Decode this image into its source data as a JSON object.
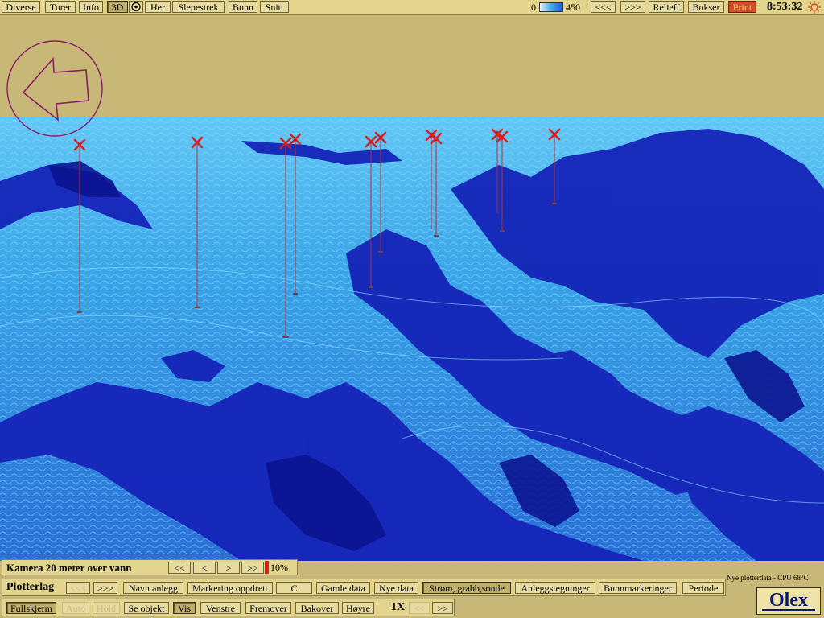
{
  "menu": {
    "items": [
      "Diverse",
      "Turer",
      "Info",
      "3D",
      "Her",
      "Slepestrek",
      "Bunn",
      "Snitt"
    ],
    "selected": "3D"
  },
  "depth_scale": {
    "min": "0",
    "max": "450"
  },
  "nav": {
    "prev": "<<<",
    "next": ">>>"
  },
  "right_menu": {
    "relief": "Relieff",
    "boxes": "Bokser",
    "print": "Print"
  },
  "clock": "8:53:32",
  "camera": {
    "label": "Kamera 20 meter over vann",
    "buttons": [
      "<<",
      "<",
      ">",
      ">>"
    ],
    "zoom": "10%"
  },
  "plotter_row": {
    "label": "Plotterlag",
    "prev": "<<<",
    "next": ">>>",
    "items": [
      "Navn anlegg",
      "Markering oppdrett",
      "C",
      "Gamle data",
      "Nye data",
      "Strøm, grabb,sonde",
      "Anleggstegninger",
      "Bunnmarkeringer",
      "Periode"
    ],
    "selected": "Strøm, grabb,sonde"
  },
  "status": "Nye plotterdata - CPU 68°C",
  "bottom_row": {
    "fullscreen": "Fullskjerm",
    "auto": "Auto",
    "hold": "Hold",
    "show_object": "Se objekt",
    "vis": "Vis",
    "left": "Venstre",
    "forward": "Fremover",
    "back": "Bakover",
    "right": "Høyre",
    "speed": "1X",
    "slower": "<<",
    "faster": ">>"
  },
  "logo": "Olex",
  "colors": {
    "panel": "#e3d48d",
    "sky": "#c8b878",
    "sea_light": "#3aa6e8",
    "sea_dark": "#1020b0",
    "marker": "#d02020"
  },
  "markers_count_label": ""
}
